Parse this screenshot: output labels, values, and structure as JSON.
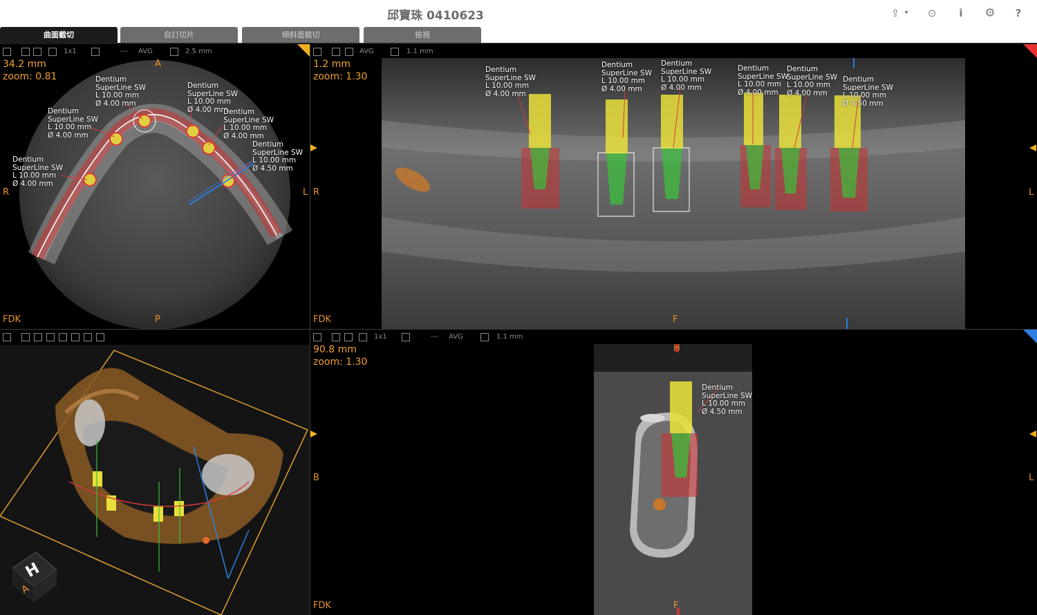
{
  "app": {
    "title": "邱寶珠 0410623"
  },
  "toolbar_icons": [
    "export-icon",
    "target-icon",
    "info-icon",
    "settings-icon",
    "help-icon"
  ],
  "toolbar_glyphs": {
    "export": "⇪",
    "dropdown": "▾",
    "target": "⊙",
    "info": "i",
    "settings": "⚙",
    "help": "?"
  },
  "tabs": [
    {
      "label": "曲面截切",
      "active": true
    },
    {
      "label": "自訂切片",
      "active": false
    },
    {
      "label": "傾斜面截切",
      "active": false
    },
    {
      "label": "檢視",
      "active": false
    }
  ],
  "views": {
    "axial": {
      "toolbar": {
        "layout": "1x1",
        "separator": "---",
        "mode": "AVG",
        "thickness": "2.5 mm"
      },
      "position": "34.2 mm",
      "zoom": "zoom: 0.81",
      "orient": {
        "top": "A",
        "bottom": "P",
        "left": "R",
        "right": "L"
      },
      "recon": "FDK",
      "labels": [
        "Dentium\nSuperLine SW\nL 10.00 mm\nØ 4.00 mm",
        "Dentium\nSuperLine SW\nL 10.00 mm\nØ 4.00 mm",
        "Dentium\nSuperLine SW\nL 10.00 mm\nØ 4.00 mm",
        "Dentium\nSuperLine SW\nL 10.00 mm\nØ 4.00 mm",
        "Dentium\nSuperLine SW\nL 10.00 mm\nØ 4.00 mm",
        "Dentium\nSuperLine SW\nL 10.00 mm\nØ 4.50 mm"
      ]
    },
    "panoramic": {
      "toolbar": {
        "mode": "AVG",
        "thickness": "1.1 mm"
      },
      "position": "1.2 mm",
      "zoom": "zoom: 1.30",
      "orient": {
        "left": "R",
        "right": "L",
        "bottom": "F"
      },
      "recon": "FDK",
      "labels": [
        "Dentium\nSuperLine SW\nL 10.00 mm\nØ 4.00 mm",
        "Dentium\nSuperLine SW\nL 10.00 mm\nØ 4.00 mm",
        "Dentium\nSuperLine SW\nL 10.00 mm\nØ 4.00 mm",
        "Dentium\nSuperLine SW\nL 10.00 mm\nØ 4.00 mm",
        "Dentium\nSuperLine SW\nL 10.00 mm\nØ 4.00 mm",
        "Dentium\nSuperLine SW\nL 10.00 mm\nØ 4.50 mm"
      ]
    },
    "volume3d": {
      "cube_label": "H",
      "cube_sub": "A"
    },
    "cross": {
      "toolbar": {
        "layout": "1x1",
        "separator": "---",
        "mode": "AVG",
        "thickness": "1.1 mm"
      },
      "position": "90.8 mm",
      "zoom": "zoom: 1.30",
      "orient": {
        "top": "H",
        "left": "B",
        "right": "L",
        "bottom": "F"
      },
      "recon": "FDK",
      "label": "Dentium\nSuperLine SW\nL 10.00 mm\nØ 4.50 mm"
    }
  },
  "colors": {
    "overlay_text": "#f0a030",
    "implant": "#e8e03a",
    "safety_zone": "#d83a3a",
    "nerve": "#d83a3a",
    "accent_blue": "#2f7fe0"
  }
}
